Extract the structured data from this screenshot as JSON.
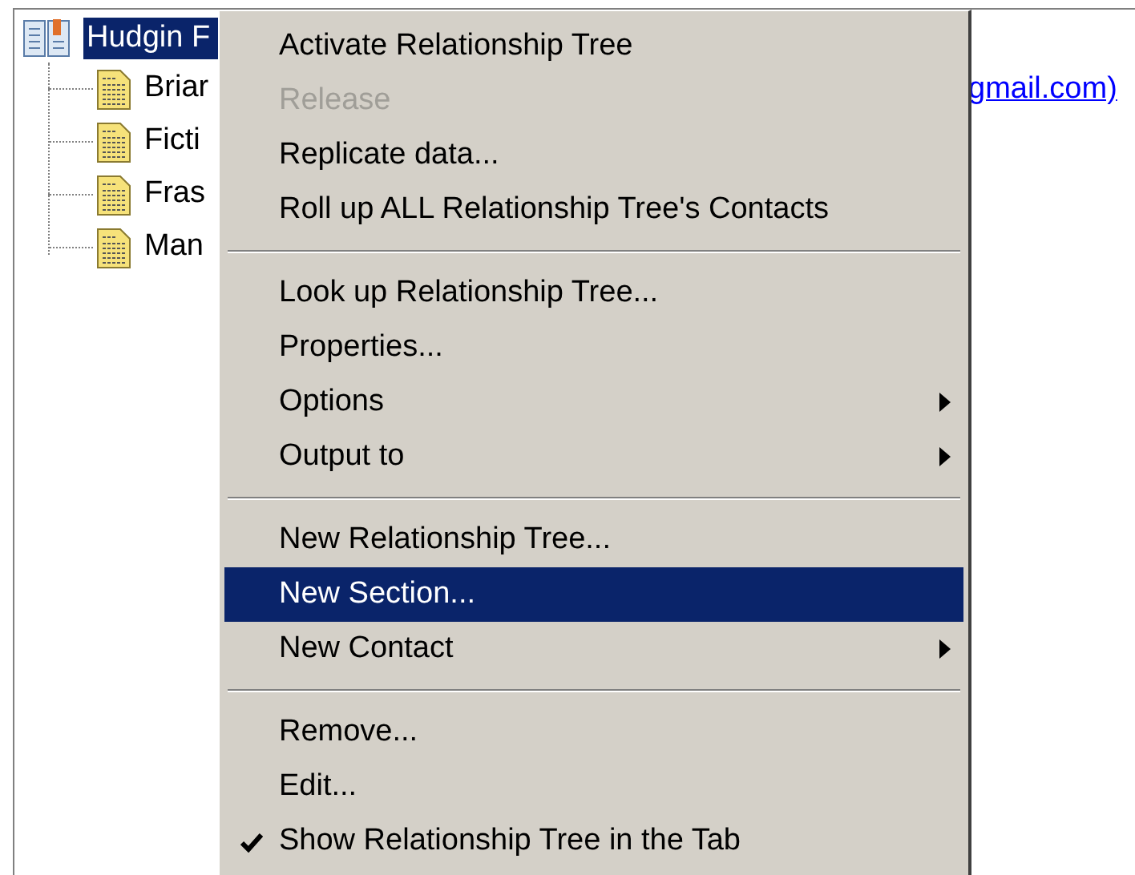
{
  "tree": {
    "root": {
      "label": "Hudgin F",
      "selected": true,
      "children": [
        {
          "label": "Briar"
        },
        {
          "label": "Ficti"
        },
        {
          "label": "Fras"
        },
        {
          "label": "Man"
        }
      ]
    }
  },
  "link": "gmail.com)",
  "context_menu": {
    "groups": [
      {
        "items": [
          {
            "label": "Activate Relationship Tree",
            "disabled": false,
            "selected": false
          },
          {
            "label": "Release",
            "disabled": true,
            "selected": false
          },
          {
            "label": "Replicate data...",
            "disabled": false,
            "selected": false
          },
          {
            "label": "Roll up ALL Relationship Tree's Contacts",
            "disabled": false,
            "selected": false
          }
        ]
      },
      {
        "items": [
          {
            "label": "Look up Relationship Tree...",
            "disabled": false,
            "selected": false
          },
          {
            "label": "Properties...",
            "disabled": false,
            "selected": false
          },
          {
            "label": "Options",
            "disabled": false,
            "selected": false,
            "submenu": true
          },
          {
            "label": "Output to",
            "disabled": false,
            "selected": false,
            "submenu": true
          }
        ]
      },
      {
        "items": [
          {
            "label": "New Relationship Tree...",
            "disabled": false,
            "selected": false
          },
          {
            "label": "New Section...",
            "disabled": false,
            "selected": true
          },
          {
            "label": "New Contact",
            "disabled": false,
            "selected": false,
            "submenu": true
          }
        ]
      },
      {
        "items": [
          {
            "label": "Remove...",
            "disabled": false,
            "selected": false
          },
          {
            "label": "Edit...",
            "disabled": false,
            "selected": false
          },
          {
            "label": "Show Relationship Tree in the Tab",
            "disabled": false,
            "selected": false,
            "checked": true
          }
        ]
      }
    ]
  }
}
